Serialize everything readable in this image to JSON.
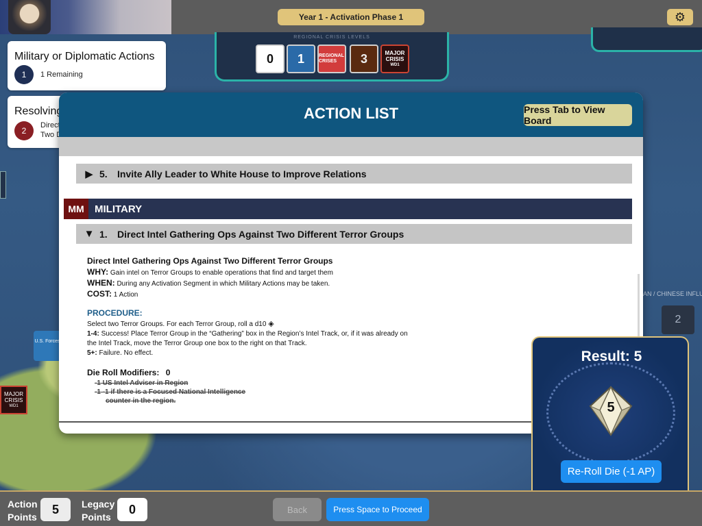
{
  "header": {
    "phase": "Year 1  -  Activation Phase 1",
    "settings_icon": "gear-icon"
  },
  "crisis_tray": {
    "caption": "REGIONAL CRISIS LEVELS",
    "levels": [
      "0",
      "1",
      "REGIONAL CRISES",
      "3"
    ],
    "major": {
      "line1": "MAJOR",
      "line2": "CRISIS",
      "line3": "WD1"
    }
  },
  "cards": {
    "actions": {
      "title": "Military or Diplomatic Actions",
      "badge": "1",
      "sub": "1 Remaining"
    },
    "resolving": {
      "title": "Resolving",
      "badge": "2",
      "sub1": "Direct",
      "sub2": "Two D"
    }
  },
  "board": {
    "us_forces": "U.S. Forces",
    "left_major": {
      "line1": "MAJOR",
      "line2": "CRISIS",
      "line3": "WD1"
    },
    "influence_label": "AN / CHINESE INFLU",
    "influence_value": "2"
  },
  "modal": {
    "title": "ACTION LIST",
    "tab_button": "Press Tab to View Board",
    "rows": [
      {
        "num": "5.",
        "label": "Invite Ally Leader to White House to Improve Relations",
        "expanded": false
      }
    ],
    "section": {
      "code": "MM",
      "label": "MILITARY"
    },
    "military_rows": [
      {
        "num": "1.",
        "label": "Direct Intel Gathering Ops Against Two Different Terror Groups",
        "expanded": true
      }
    ],
    "detail": {
      "title": "Direct Intel Gathering Ops Against Two Different Terror Groups",
      "why_label": "WHY:",
      "why": "Gain intel on Terror Groups to enable operations that find and target them",
      "when_label": "WHEN:",
      "when": "During any Activation Segment in which Military Actions may be taken.",
      "cost_label": "COST:",
      "cost": "1 Action",
      "procedure_heading": "PROCEDURE:",
      "procedure_intro": "Select two Terror Groups. For each Terror Group, roll a d10",
      "success_label": "1-4:",
      "success": "Success! Place Terror Group in the “Gathering” box in the Region’s Intel Track, or, if it was already on the Intel Track, move the Terror Group one box to the right on that Track.",
      "fail_label": "5+:",
      "fail": "Failure. No effect.",
      "modifiers_label": "Die Roll Modifiers:",
      "modifiers_value": "0",
      "mod1": "-1   US Intel Adviser in Region",
      "mod2": "-1   -1 if there is a Focused National Intelligence",
      "mod2b": "counter in the region."
    }
  },
  "dice": {
    "result": "Result: 5",
    "value": "5",
    "reroll": "Re-Roll Die (-1 AP)"
  },
  "footer": {
    "ap_label1": "Action",
    "ap_label2": "Points",
    "ap_value": "5",
    "legacy_label1": "Legacy",
    "legacy_label2": "Points",
    "legacy_value": "0",
    "back": "Back",
    "proceed": "Press Space to Proceed"
  },
  "colors": {
    "header_blue": "#0f567f",
    "military_red": "#6e1010",
    "accent_gold": "#e0c47a",
    "button_blue": "#1e8ef0"
  }
}
